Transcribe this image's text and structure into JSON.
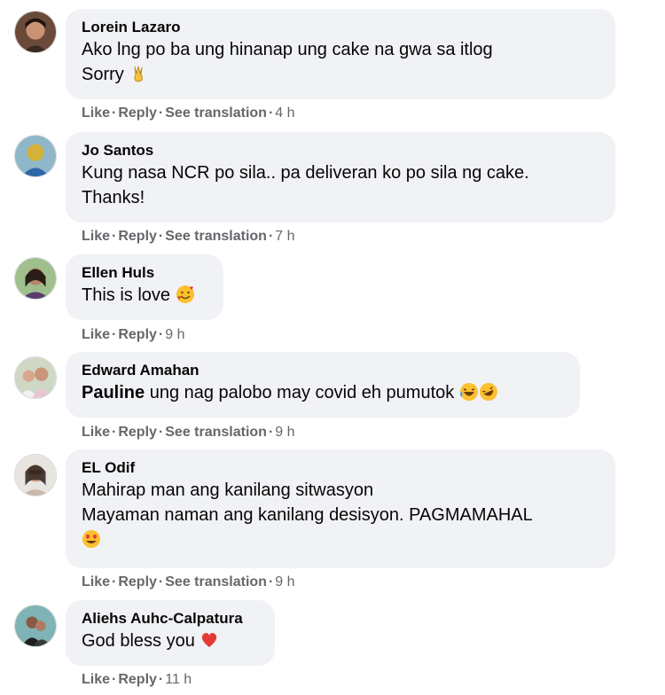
{
  "comments": [
    {
      "name": "Lorein Lazaro",
      "line1": "Ako lng po ba ung hinanap ung cake na gwa sa itlog",
      "line2": "Sorry",
      "line2_emoji": "victory-hand-emoji",
      "like": "Like",
      "reply": "Reply",
      "translate": "See translation",
      "time": "4 h"
    },
    {
      "name": "Jo Santos",
      "line1": "Kung nasa NCR po sila.. pa deliveran ko po sila ng cake.",
      "line2": "Thanks!",
      "like": "Like",
      "reply": "Reply",
      "translate": "See translation",
      "time": "7 h"
    },
    {
      "name": "Ellen Huls",
      "line1": "This is love",
      "line1_emoji": "smiling-face-with-hearts-emoji",
      "like": "Like",
      "reply": "Reply",
      "time": "9 h"
    },
    {
      "name": "Edward Amahan",
      "mention": "Pauline",
      "line1": " ung nag palobo may covid eh pumutok",
      "line1_emoji": "laughing-emojis",
      "like": "Like",
      "reply": "Reply",
      "translate": "See translation",
      "time": "9 h"
    },
    {
      "name": "EL Odif",
      "line1": "Mahirap man ang kanilang sitwasyon",
      "line2": "Mayaman naman ang kanilang desisyon. PAGMAMAHAL",
      "line3_emoji": "heart-eyes-emoji",
      "like": "Like",
      "reply": "Reply",
      "translate": "See translation",
      "time": "9 h"
    },
    {
      "name": "Aliehs Auhc-Calpatura",
      "line1": "God bless you",
      "line1_emoji": "red-heart-emoji",
      "like": "Like",
      "reply": "Reply",
      "time": "11 h"
    }
  ],
  "separator": "·"
}
